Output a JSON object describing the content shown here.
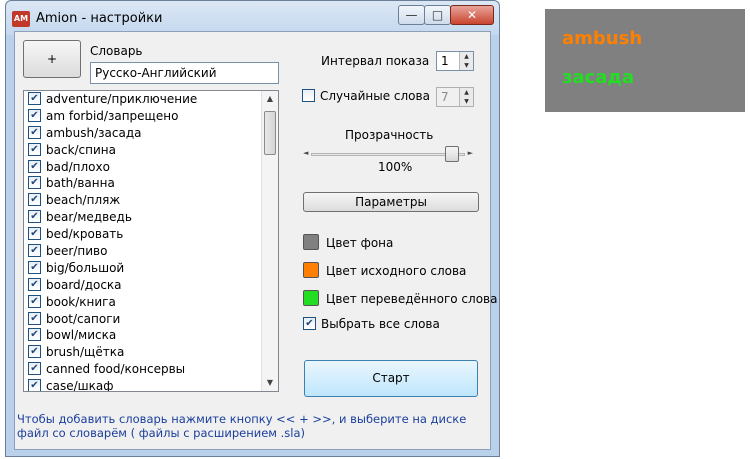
{
  "window": {
    "title": "Amion - настройки",
    "app_icon_text": "AM",
    "minimize": "—",
    "maximize": "□",
    "close": "✕"
  },
  "dictionary": {
    "add_button": "+",
    "label": "Словарь",
    "name": "Русско-Английский"
  },
  "words": [
    {
      "text": "adventure/приключение",
      "checked": true
    },
    {
      "text": "am forbid/запрещено",
      "checked": true
    },
    {
      "text": "ambush/засада",
      "checked": true
    },
    {
      "text": "back/спина",
      "checked": true
    },
    {
      "text": "bad/плохо",
      "checked": true
    },
    {
      "text": "bath/ванна",
      "checked": true
    },
    {
      "text": "beach/пляж",
      "checked": true
    },
    {
      "text": "bear/медведь",
      "checked": true
    },
    {
      "text": "bed/кровать",
      "checked": true
    },
    {
      "text": "beer/пиво",
      "checked": true
    },
    {
      "text": "big/большой",
      "checked": true
    },
    {
      "text": "board/доска",
      "checked": true
    },
    {
      "text": "book/книга",
      "checked": true
    },
    {
      "text": "boot/сапоги",
      "checked": true
    },
    {
      "text": "bowl/миска",
      "checked": true
    },
    {
      "text": "brush/щётка",
      "checked": true
    },
    {
      "text": "canned food/консервы",
      "checked": true
    },
    {
      "text": "case/шкаф",
      "checked": true
    }
  ],
  "settings": {
    "interval_label": "Интервал показа",
    "interval_value": "1",
    "random_label": "Случайные слова",
    "random_checked": false,
    "random_value": "7",
    "opacity_label": "Прозрачность",
    "opacity_value": "100%",
    "params_button": "Параметры",
    "bg_color_label": "Цвет фона",
    "src_color_label": "Цвет исходного слова",
    "dst_color_label": "Цвет переведённого слова",
    "select_all_label": "Выбрать все слова",
    "select_all_checked": true,
    "start_button": "Старт"
  },
  "colors": {
    "background": "#808080",
    "source_word": "#ff8000",
    "translated_word": "#22dd22"
  },
  "hint": "Чтобы добавить словарь нажмите кнопку  << + >>, и выберите на диске файл со словарём ( файлы с расширением .sla)",
  "preview": {
    "source": "ambush",
    "translation": "засада"
  }
}
